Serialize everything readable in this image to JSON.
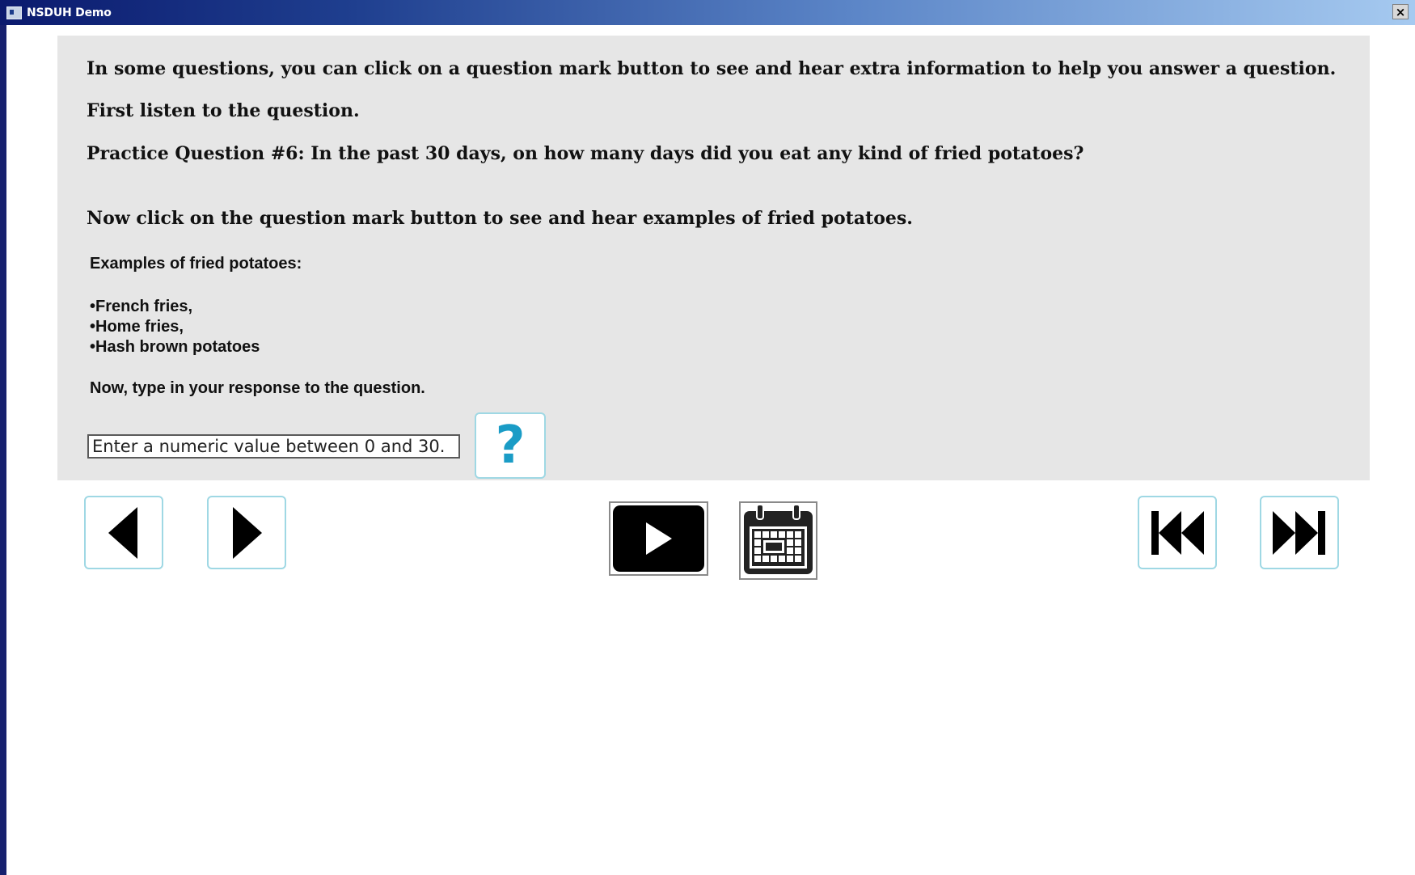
{
  "window": {
    "title": "NSDUH Demo",
    "close_glyph": "×"
  },
  "content": {
    "line1": "In some questions, you can click on a question mark button to see and hear extra information to help you answer a question.",
    "line2": "First listen to the question.",
    "line3": "Practice Question #6: In the past 30 days, on how many days did you eat any kind of fried potatoes?",
    "line4": "Now click on the question mark button to see and hear examples of fried potatoes.",
    "examples_heading": "Examples of fried potatoes:",
    "examples": [
      "French fries,",
      "Home fries,",
      "Hash brown potatoes"
    ],
    "response_prompt": "Now, type in your response to the question."
  },
  "response": {
    "value": "",
    "placeholder": "Enter a numeric value between 0 and 30."
  },
  "help_button": {
    "label": "?",
    "color": "#1a9cc6"
  },
  "icons": {
    "previous": "arrow-left-icon",
    "next": "arrow-right-icon",
    "play": "play-icon",
    "calendar": "calendar-icon",
    "first": "skip-to-start-icon",
    "last": "skip-to-end-icon"
  },
  "colors": {
    "panel_bg": "#e6e6e6",
    "button_border": "#9fd8e4",
    "title_bar_start": "#0b1a6e",
    "title_bar_end": "#a6caf0"
  }
}
